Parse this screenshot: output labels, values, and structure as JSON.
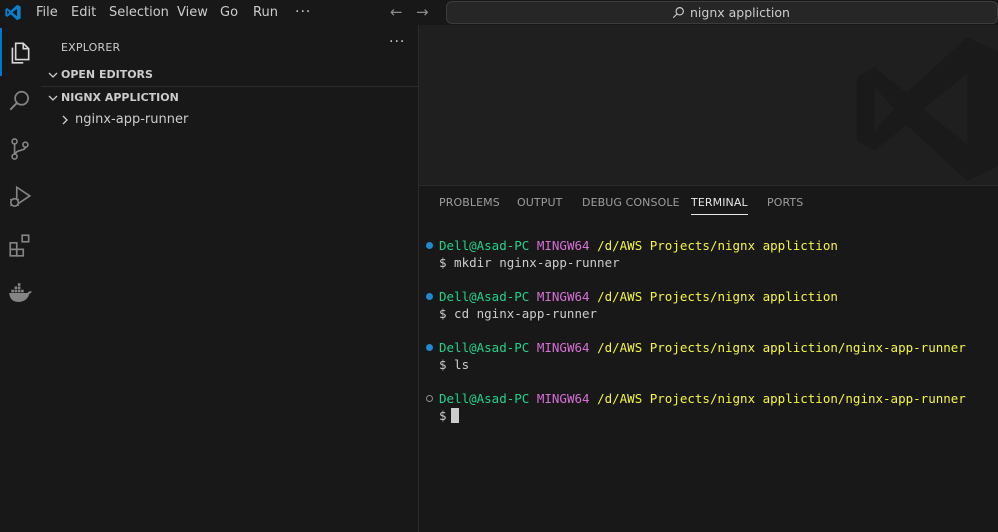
{
  "app": {
    "name": "Visual Studio Code"
  },
  "titlebar": {
    "menu": [
      "File",
      "Edit",
      "Selection",
      "View",
      "Go",
      "Run"
    ],
    "more_icon": "ellipsis-icon",
    "back_icon": "arrow-left-icon",
    "forward_icon": "arrow-right-icon",
    "search_text": "nignx appliction",
    "search_icon": "search-icon"
  },
  "activity_bar": {
    "items": [
      "files-icon",
      "search-icon",
      "source-control-icon",
      "run-debug-icon",
      "extensions-icon",
      "docker-icon"
    ],
    "active": "files-icon",
    "accent": "#0078d4"
  },
  "sidebar": {
    "title": "EXPLORER",
    "more": "···",
    "sections": [
      {
        "label": "OPEN EDITORS",
        "expanded": true
      },
      {
        "label": "NIGNX APPLICTION",
        "expanded": true
      }
    ],
    "tree": [
      {
        "label": "nginx-app-runner",
        "type": "folder",
        "expanded": false
      }
    ]
  },
  "panel": {
    "tabs": [
      "PROBLEMS",
      "OUTPUT",
      "DEBUG CONSOLE",
      "TERMINAL",
      "PORTS"
    ],
    "active_tab": "TERMINAL"
  },
  "terminal": {
    "colors": {
      "user": "#23d18b",
      "system": "#d670d6",
      "path": "#f5f543",
      "dot_success": "#1f8ad2"
    },
    "entries": [
      {
        "user": "Dell@Asad-PC",
        "system": "MINGW64",
        "path": "/d/AWS Projects/nignx appliction",
        "command": "$ mkdir nginx-app-runner",
        "status": "success"
      },
      {
        "user": "Dell@Asad-PC",
        "system": "MINGW64",
        "path": "/d/AWS Projects/nignx appliction",
        "command": "$ cd nginx-app-runner",
        "status": "success"
      },
      {
        "user": "Dell@Asad-PC",
        "system": "MINGW64",
        "path": "/d/AWS Projects/nignx appliction/nginx-app-runner",
        "command": "$ ls",
        "status": "success"
      },
      {
        "user": "Dell@Asad-PC",
        "system": "MINGW64",
        "path": "/d/AWS Projects/nignx appliction/nginx-app-runner",
        "command": "$",
        "status": "pending"
      }
    ]
  }
}
